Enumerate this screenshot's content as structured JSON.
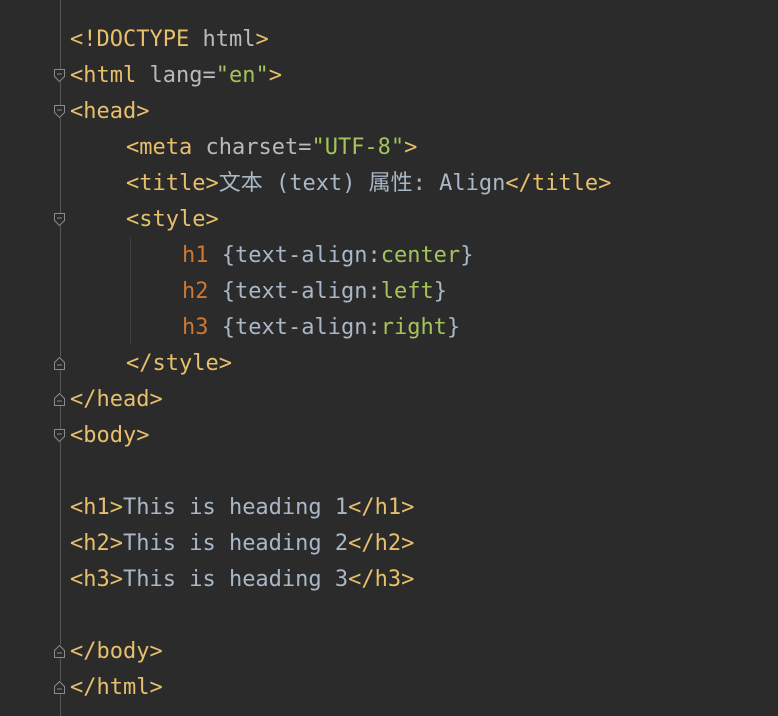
{
  "editor": {
    "lines": [
      {
        "fold": null,
        "indent": 0,
        "tokens": [
          {
            "t": "tag",
            "v": "<!DOCTYPE "
          },
          {
            "t": "attr",
            "v": "html"
          },
          {
            "t": "tag",
            "v": ">"
          }
        ]
      },
      {
        "fold": "open",
        "indent": 0,
        "tokens": [
          {
            "t": "tag",
            "v": "<html "
          },
          {
            "t": "attr",
            "v": "lang="
          },
          {
            "t": "val",
            "v": "\"en\""
          },
          {
            "t": "tag",
            "v": ">"
          }
        ]
      },
      {
        "fold": "open",
        "indent": 0,
        "tokens": [
          {
            "t": "tag",
            "v": "<head>"
          }
        ]
      },
      {
        "fold": null,
        "indent": 1,
        "tokens": [
          {
            "t": "tag",
            "v": "<meta "
          },
          {
            "t": "attr",
            "v": "charset="
          },
          {
            "t": "val",
            "v": "\"UTF-8\""
          },
          {
            "t": "tag",
            "v": ">"
          }
        ]
      },
      {
        "fold": null,
        "indent": 1,
        "tokens": [
          {
            "t": "tag",
            "v": "<title>"
          },
          {
            "t": "text",
            "v": "文本 (text) 属性: Align"
          },
          {
            "t": "tag",
            "v": "</title>"
          }
        ]
      },
      {
        "fold": "open",
        "indent": 1,
        "tokens": [
          {
            "t": "tag",
            "v": "<style>"
          }
        ]
      },
      {
        "fold": null,
        "indent": 2,
        "tokens": [
          {
            "t": "sel",
            "v": "h1 "
          },
          {
            "t": "text",
            "v": "{text-align:"
          },
          {
            "t": "pval",
            "v": "center"
          },
          {
            "t": "text",
            "v": "}"
          }
        ]
      },
      {
        "fold": null,
        "indent": 2,
        "tokens": [
          {
            "t": "sel",
            "v": "h2 "
          },
          {
            "t": "text",
            "v": "{text-align:"
          },
          {
            "t": "pval",
            "v": "left"
          },
          {
            "t": "text",
            "v": "}"
          }
        ]
      },
      {
        "fold": null,
        "indent": 2,
        "tokens": [
          {
            "t": "sel",
            "v": "h3 "
          },
          {
            "t": "text",
            "v": "{text-align:"
          },
          {
            "t": "pval",
            "v": "right"
          },
          {
            "t": "text",
            "v": "}"
          }
        ]
      },
      {
        "fold": "close",
        "indent": 1,
        "tokens": [
          {
            "t": "tag",
            "v": "</style>"
          }
        ]
      },
      {
        "fold": "close",
        "indent": 0,
        "tokens": [
          {
            "t": "tag",
            "v": "</head>"
          }
        ]
      },
      {
        "fold": "open",
        "indent": 0,
        "tokens": [
          {
            "t": "tag",
            "v": "<body>"
          }
        ]
      },
      {
        "fold": null,
        "indent": 0,
        "tokens": []
      },
      {
        "fold": null,
        "indent": 0,
        "tokens": [
          {
            "t": "tag",
            "v": "<h1>"
          },
          {
            "t": "text",
            "v": "This is heading 1"
          },
          {
            "t": "tag",
            "v": "</h1>"
          }
        ]
      },
      {
        "fold": null,
        "indent": 0,
        "tokens": [
          {
            "t": "tag",
            "v": "<h2>"
          },
          {
            "t": "text",
            "v": "This is heading 2"
          },
          {
            "t": "tag",
            "v": "</h2>"
          }
        ]
      },
      {
        "fold": null,
        "indent": 0,
        "tokens": [
          {
            "t": "tag",
            "v": "<h3>"
          },
          {
            "t": "text",
            "v": "This is heading 3"
          },
          {
            "t": "tag",
            "v": "</h3>"
          }
        ]
      },
      {
        "fold": null,
        "indent": 0,
        "tokens": []
      },
      {
        "fold": "close",
        "indent": 0,
        "tokens": [
          {
            "t": "tag",
            "v": "</body>"
          }
        ]
      },
      {
        "fold": "close",
        "indent": 0,
        "tokens": [
          {
            "t": "tag",
            "v": "</html>"
          }
        ]
      }
    ]
  },
  "colors": {
    "background": "#2b2b2b",
    "tag": "#e8bf6a",
    "attribute": "#bababa",
    "attribute_value": "#a5c25c",
    "text": "#a9b7c6",
    "css_selector": "#cc7832",
    "css_value": "#a5c25c"
  }
}
